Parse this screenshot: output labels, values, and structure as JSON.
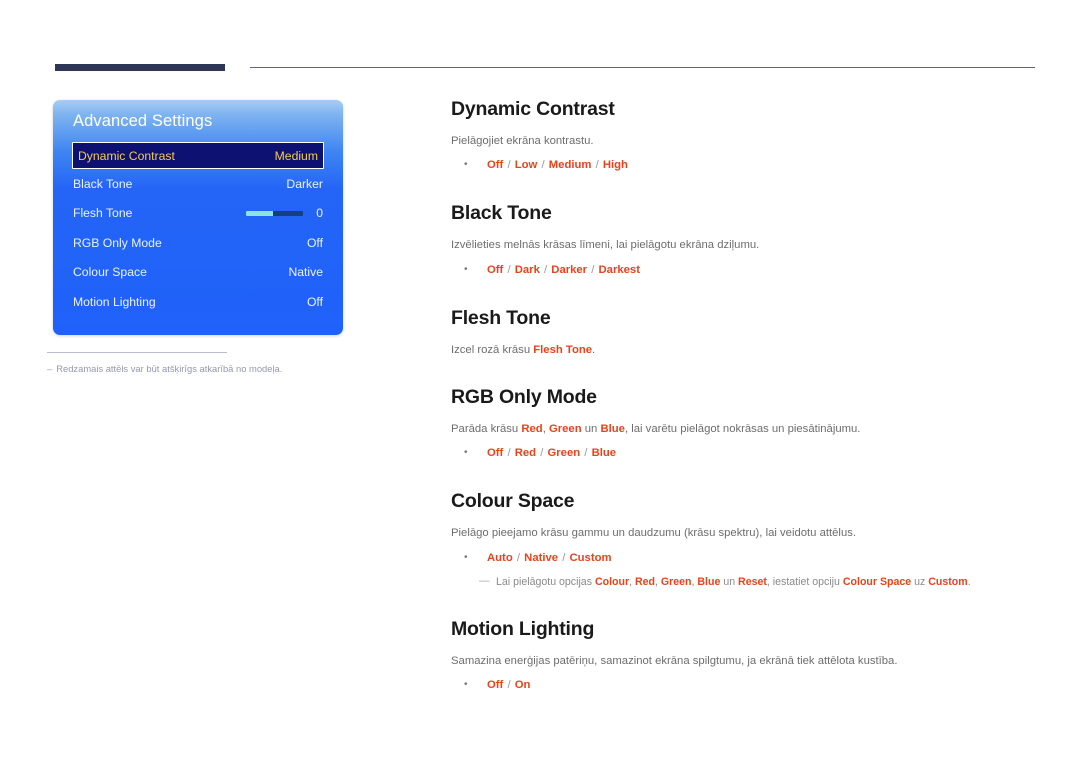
{
  "header": {
    "rule_accent_color": "#2e3655",
    "rule_line_color": "#63627a"
  },
  "osd": {
    "title": "Advanced Settings",
    "panel_color": "#1f62fa",
    "selected_bg": "#0d1172",
    "selected_text_color": "#f5cb53",
    "rows": [
      {
        "label": "Dynamic Contrast",
        "value": "Medium",
        "selected": true,
        "type": "value"
      },
      {
        "label": "Black Tone",
        "value": "Darker",
        "selected": false,
        "type": "value"
      },
      {
        "label": "Flesh Tone",
        "value": "0",
        "selected": false,
        "type": "slider",
        "slider_percent": 47
      },
      {
        "label": "RGB Only Mode",
        "value": "Off",
        "selected": false,
        "type": "value"
      },
      {
        "label": "Colour Space",
        "value": "Native",
        "selected": false,
        "type": "value"
      },
      {
        "label": "Motion Lighting",
        "value": "Off",
        "selected": false,
        "type": "value"
      }
    ]
  },
  "footnote": {
    "dash": "–",
    "text": "Redzamais attēls var būt atšķirīgs atkarībā no modeļa."
  },
  "sections": {
    "dynamic_contrast": {
      "title": "Dynamic Contrast",
      "desc": "Pielāgojiet ekrāna kontrastu.",
      "options": [
        "Off",
        "Low",
        "Medium",
        "High"
      ]
    },
    "black_tone": {
      "title": "Black Tone",
      "desc": "Izvēlieties melnās krāsas līmeni, lai pielāgotu ekrāna dziļumu.",
      "options": [
        "Off",
        "Dark",
        "Darker",
        "Darkest"
      ]
    },
    "flesh_tone": {
      "title": "Flesh Tone",
      "desc_pre": "Izcel rozā krāsu ",
      "desc_kw": "Flesh Tone",
      "desc_post": "."
    },
    "rgb_only_mode": {
      "title": "RGB Only Mode",
      "desc_p1": "Parāda krāsu ",
      "desc_kw1": "Red",
      "desc_p2": ", ",
      "desc_kw2": "Green",
      "desc_p3": " un ",
      "desc_kw3": "Blue",
      "desc_p4": ", lai varētu pielāgot nokrāsas un piesātinājumu.",
      "options": [
        "Off",
        "Red",
        "Green",
        "Blue"
      ]
    },
    "colour_space": {
      "title": "Colour Space",
      "desc": "Pielāgo pieejamo krāsu gammu un daudzumu (krāsu spektru), lai veidotu attēlus.",
      "options": [
        "Auto",
        "Native",
        "Custom"
      ],
      "note_emdash": "—",
      "note_p1": "Lai pielāgotu opcijas ",
      "note_kw1": "Colour",
      "note_p2": ", ",
      "note_kw2": "Red",
      "note_p3": ", ",
      "note_kw3": "Green",
      "note_p4": ", ",
      "note_kw4": "Blue",
      "note_p5": " un ",
      "note_kw5": "Reset",
      "note_p6": ", iestatiet opciju ",
      "note_kw6": "Colour Space",
      "note_p7": " uz ",
      "note_kw7": "Custom",
      "note_p8": "."
    },
    "motion_lighting": {
      "title": "Motion Lighting",
      "desc": "Samazina enerģijas patēriņu, samazinot ekrāna spilgtumu, ja ekrānā tiek attēlota kustība.",
      "options": [
        "Off",
        "On"
      ]
    }
  }
}
